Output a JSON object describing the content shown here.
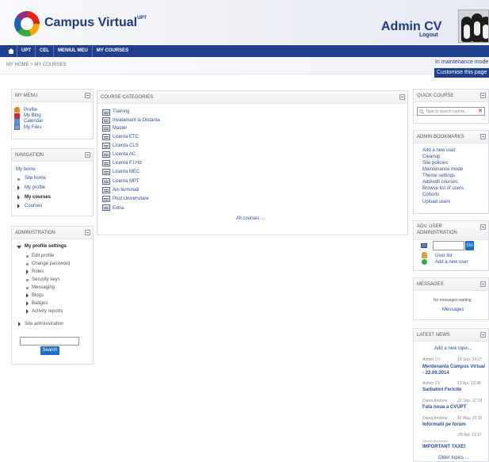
{
  "header": {
    "site_title": "Campus Virtual",
    "site_title_sup": "UPT",
    "user_name": "Admin CV",
    "logout": "Logout"
  },
  "navbar": {
    "items": [
      "UPT",
      "CEL",
      "MENIUL MEU",
      "MY COURSES"
    ]
  },
  "breadcrumb": "MY HOME > MY COURSES",
  "maintenance_notice": "In maintenance mode",
  "customise_button": "Customise this page",
  "my_menu": {
    "title": "MY MENU",
    "items": [
      "Profile",
      "My Blog",
      "Calendar",
      "My Files"
    ]
  },
  "navigation": {
    "title": "NAVIGATION",
    "items": [
      "My home",
      "Site home",
      "My profile",
      "My courses",
      "Courses"
    ]
  },
  "administration": {
    "title": "ADMINISTRATION",
    "profile_settings": "My profile settings",
    "items": [
      "Edit profile",
      "Change password",
      "Roles",
      "Security keys",
      "Messaging",
      "Blogs",
      "Badges",
      "Activity reports"
    ],
    "site_admin": "Site administration",
    "search_button": "Search"
  },
  "course_categories": {
    "title": "COURSE CATEGORIES",
    "items": [
      "Training",
      "Invatamant la Distanta",
      "Master",
      "Licenta ETC",
      "Licenta CLS",
      "Licenta AC",
      "Licenta F.I.Hd",
      "Licenta MEC",
      "Licenta MPT",
      "Ani terminati",
      "Post Universitare",
      "Extra"
    ],
    "all_courses": "All courses ..."
  },
  "quick_course": {
    "title": "QUICK COURSE",
    "placeholder": "Type to search course..."
  },
  "admin_bookmarks": {
    "title": "ADMIN BOOKMARKS",
    "items": [
      "Add a new user",
      "Cleanup",
      "Site policies",
      "Maintenance mode",
      "Theme settings",
      "Add/edit courses",
      "Browse list of users",
      "Cohorts",
      "Upload users"
    ]
  },
  "adv_user_admin": {
    "title": "ADV. USER ADMINISTRATION",
    "go_button": "Go",
    "user_list": "User list",
    "add_user": "Add a new user"
  },
  "messages": {
    "title": "MESSAGES",
    "no_messages": "No messages waiting",
    "link": "Messages"
  },
  "latest_news": {
    "title": "LATEST NEWS",
    "add_topic": "Add a new topic...",
    "items": [
      {
        "author": "Admin CV",
        "date": "19 Sep, 14:27",
        "title": "Mentenanta Campus Virtual - 22.09.2014"
      },
      {
        "author": "Admin CV",
        "date": "13 Apr, 13:38",
        "title": "Sarbatori Fericite"
      },
      {
        "author": "Diana Andone",
        "date": "22 Sep, 12:19",
        "title": "Fata noua a CVUPT"
      },
      {
        "author": "Diana Andone",
        "date": "15 May, 20:32",
        "title": "Informatii pe forum"
      },
      {
        "author": "Tiberiu Semesiosi",
        "date": "28 Apr, 13:17",
        "title": "IMPORTANT TAXE!"
      }
    ],
    "older_topics": "Older topics ..."
  }
}
